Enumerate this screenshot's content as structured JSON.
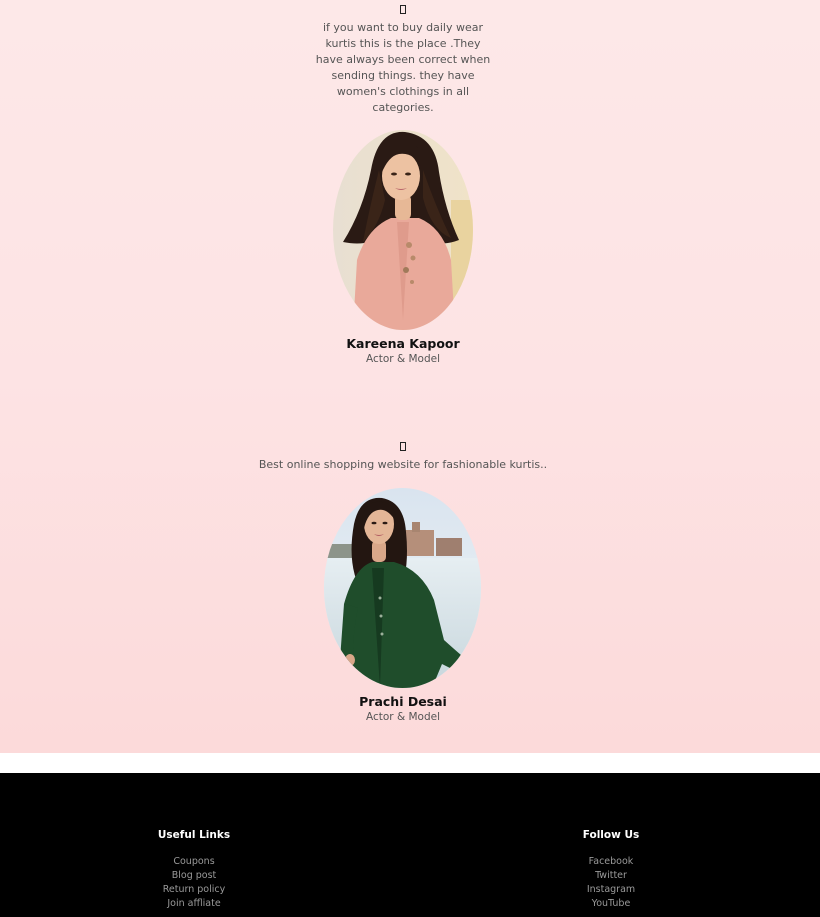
{
  "testimonials": [
    {
      "quote_icon": "quote-icon",
      "text": "if you want to buy daily wear kurtis this is the place .They have always been correct when sending things. they have women's clothings in all categories.",
      "name": "Kareena Kapoor",
      "role": "Actor & Model",
      "outfit_color": "#e9a99a"
    },
    {
      "quote_icon": "quote-icon",
      "text": "Best online shopping website for fashionable kurtis..",
      "name": "Prachi Desai",
      "role": "Actor & Model",
      "outfit_color": "#1f4d2b"
    }
  ],
  "footer": {
    "useful_links": {
      "heading": "Useful Links",
      "items": [
        "Coupons",
        "Blog post",
        "Return policy",
        "Join affliate"
      ]
    },
    "follow_us": {
      "heading": "Follow Us",
      "items": [
        "Facebook",
        "Twitter",
        "Instagram",
        "YouTube"
      ]
    }
  },
  "colors": {
    "section_bg": "#fde3e4",
    "footer_bg": "#000000",
    "heading_text": "#111111",
    "muted_text": "#555555",
    "footer_link": "#9a9a9a"
  }
}
